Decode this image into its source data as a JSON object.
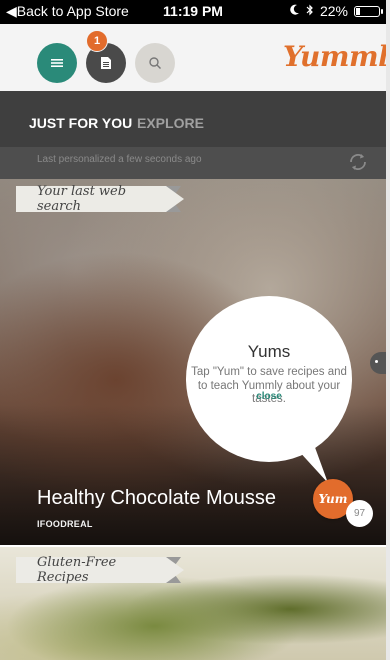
{
  "status_bar": {
    "back_label": "◀Back to App Store",
    "time": "11:19 PM",
    "battery": "22%",
    "battery_level": 0.22
  },
  "toolbar": {
    "badge_count": "1",
    "logo": "Yummly"
  },
  "tabs": [
    {
      "label": "JUST FOR YOU",
      "active": true
    },
    {
      "label": "EXPLORE",
      "active": false
    }
  ],
  "personalization": {
    "text": "Last personalized a few seconds ago"
  },
  "feed": [
    {
      "ribbon": "Your last web search",
      "title": "Healthy Chocolate Mousse",
      "source": "IFOODREAL",
      "yum_label": "Yum",
      "yum_count": "97"
    },
    {
      "ribbon": "Gluten-Free Recipes"
    }
  ],
  "tooltip": {
    "title": "Yums",
    "body": "Tap \"Yum\" to save recipes and to teach Yummly about your tastes.",
    "close_label": "close"
  },
  "colors": {
    "brand_orange": "#e26c2c",
    "teal": "#2a8a79",
    "dark_tab_bar": "#3f3f3f"
  },
  "icons": {
    "menu": "hamburger-icon",
    "collections": "document-icon",
    "search": "search-icon",
    "refresh": "refresh-icon",
    "bluetooth": "bluetooth-icon",
    "moon": "moon-icon"
  }
}
